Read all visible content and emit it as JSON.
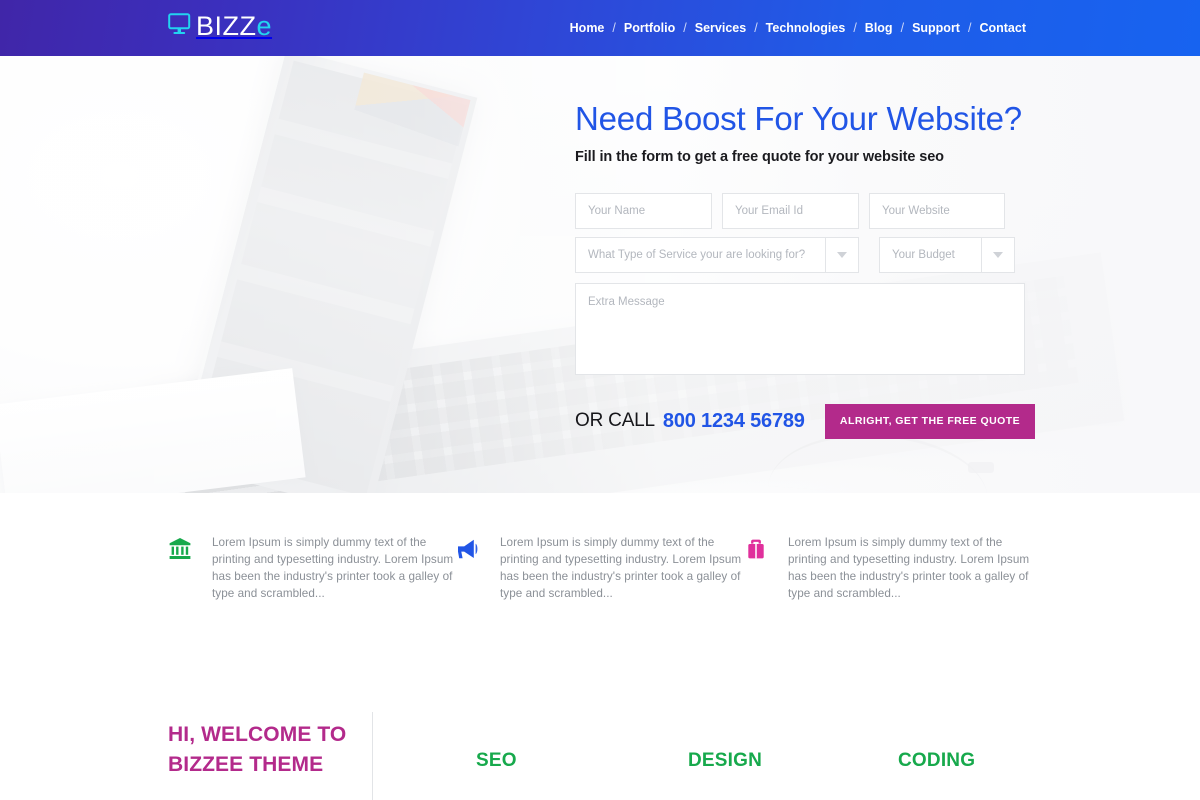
{
  "header": {
    "logo": {
      "icon": "monitor-icon",
      "text_main": "BIZZ",
      "text_tail": "e"
    },
    "nav": {
      "separator": "/",
      "items": [
        {
          "label": "Home"
        },
        {
          "label": "Portfolio"
        },
        {
          "label": "Services"
        },
        {
          "label": "Technologies"
        },
        {
          "label": "Blog"
        },
        {
          "label": "Support"
        },
        {
          "label": "Contact"
        }
      ]
    },
    "colors": {
      "gradient_start": "#4026a8",
      "gradient_end": "#1763f0",
      "logo_accent": "#22d3f0"
    }
  },
  "hero": {
    "title": "Need Boost For Your Website?",
    "subtitle": "Fill in the form to get a free quote for your website seo",
    "title_color": "#2155e6",
    "form": {
      "name_placeholder": "Your Name",
      "email_placeholder": "Your Email Id",
      "website_placeholder": "Your Website",
      "service_placeholder": "What Type of Service your are looking for?",
      "budget_placeholder": "Your Budget",
      "message_placeholder": "Extra Message",
      "name_value": "",
      "email_value": "",
      "website_value": "",
      "message_value": ""
    },
    "call": {
      "label": "OR CALL",
      "phone": "800 1234 56789",
      "phone_color": "#2155e6"
    },
    "cta": {
      "label": "ALRIGHT, GET THE FREE QUOTE",
      "color": "#b32a8b"
    }
  },
  "features": {
    "items": [
      {
        "icon": "bank-icon",
        "icon_color": "#17a94c",
        "text": "Lorem Ipsum is simply dummy text of the printing and typesetting industry. Lorem Ipsum has been the industry's printer took a galley of type and scrambled..."
      },
      {
        "icon": "megaphone-icon",
        "icon_color": "#2155e6",
        "text": "Lorem Ipsum is simply dummy text of the printing and typesetting industry. Lorem Ipsum has been the industry's printer took a galley of type and scrambled..."
      },
      {
        "icon": "briefcase-icon",
        "icon_color": "#e0309c",
        "text": "Lorem Ipsum is simply dummy text of the printing and typesetting industry. Lorem Ipsum has been the industry's printer took a galley of type and scrambled..."
      }
    ]
  },
  "welcome": {
    "title_line1": "HI, WELCOME TO",
    "title_line2": "BIZZEE THEME",
    "title_color": "#b32a8b",
    "skills": [
      {
        "label": "SEO"
      },
      {
        "label": "DESIGN"
      },
      {
        "label": "CODING"
      }
    ],
    "skill_color": "#17a94c"
  }
}
